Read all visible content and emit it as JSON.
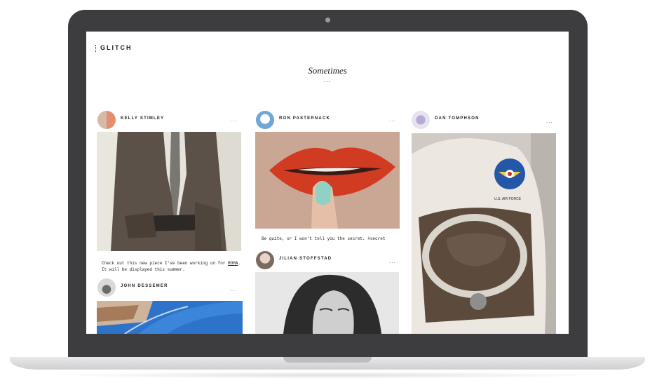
{
  "site": {
    "logo": "GLITCH",
    "title": "Sometimes",
    "title_dots": "..."
  },
  "posts": [
    {
      "author": "KELLY STIMLEY",
      "more": "...",
      "caption_pre": "Check out this new piece I've been working on for ",
      "caption_link": "MOMA",
      "caption_post": ". It will be displayed this summer."
    },
    {
      "author": "JOHN DESSEMER",
      "more": "..."
    },
    {
      "author": "RON PASTERNACK",
      "more": "...",
      "caption": "Be quite, or I won't tell you the secret. #secret"
    },
    {
      "author": "JILIAN STOFFSTAD",
      "more": "..."
    },
    {
      "author": "DAN TOMPHSON",
      "more": "...",
      "patch_text": "U.S. AIR FORCE"
    }
  ],
  "colors": {
    "bezel": "#3d3d3f",
    "screen": "#ffffff",
    "text": "#222222"
  },
  "icons": [
    "more-dots-icon",
    "camera-icon"
  ]
}
